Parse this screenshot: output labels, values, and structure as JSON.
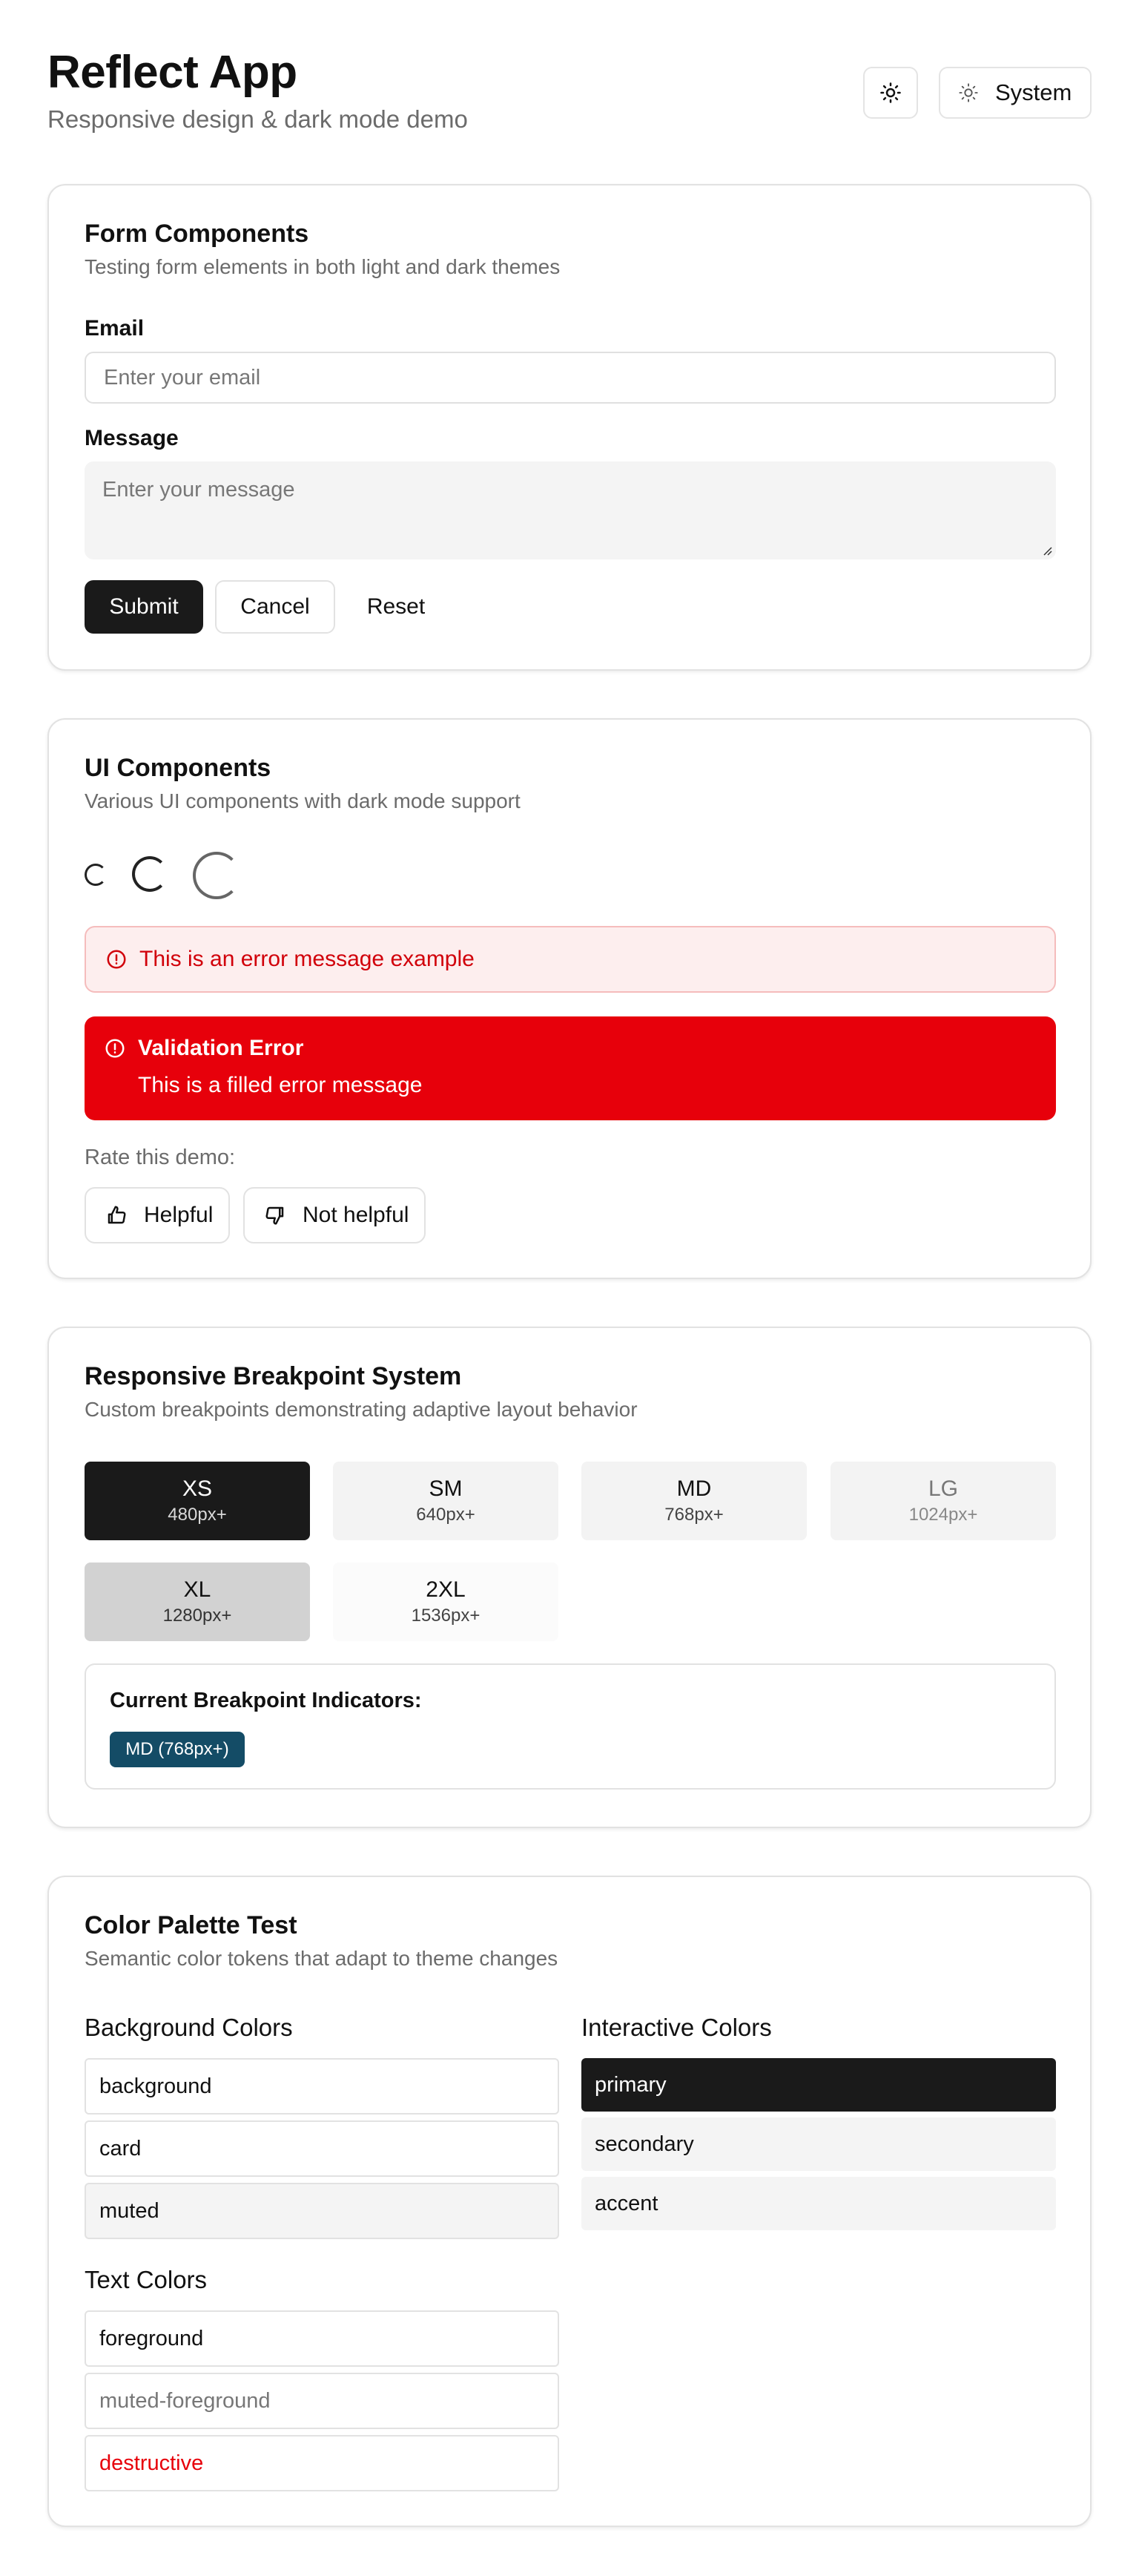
{
  "header": {
    "title": "Reflect App",
    "subtitle": "Responsive design & dark mode demo",
    "theme_toggle_icon": "sun-icon",
    "theme_select_label": "System"
  },
  "form_card": {
    "title": "Form Components",
    "description": "Testing form elements in both light and dark themes",
    "email_label": "Email",
    "email_value": "",
    "email_placeholder": "Enter your email",
    "message_label": "Message",
    "message_value": "",
    "message_placeholder": "Enter your message",
    "submit_label": "Submit",
    "cancel_label": "Cancel",
    "reset_label": "Reset"
  },
  "ui_card": {
    "title": "UI Components",
    "description": "Various UI components with dark mode support",
    "error_outline_text": "This is an error message example",
    "error_filled_title": "Validation Error",
    "error_filled_text": "This is a filled error message",
    "rate_prompt": "Rate this demo:",
    "helpful_label": "Helpful",
    "not_helpful_label": "Not helpful"
  },
  "breakpoint_card": {
    "title": "Responsive Breakpoint System",
    "description": "Custom breakpoints demonstrating adaptive layout behavior",
    "breakpoints": [
      {
        "name": "XS",
        "size": "480px+"
      },
      {
        "name": "SM",
        "size": "640px+"
      },
      {
        "name": "MD",
        "size": "768px+"
      },
      {
        "name": "LG",
        "size": "1024px+"
      },
      {
        "name": "XL",
        "size": "1280px+"
      },
      {
        "name": "2XL",
        "size": "1536px+"
      }
    ],
    "indicator_title": "Current Breakpoint Indicators:",
    "indicator_badge": "MD (768px+)"
  },
  "color_card": {
    "title": "Color Palette Test",
    "description": "Semantic color tokens that adapt to theme changes",
    "background_heading": "Background Colors",
    "background_colors": [
      "background",
      "card",
      "muted"
    ],
    "text_heading": "Text Colors",
    "text_colors": [
      "foreground",
      "muted-foreground",
      "destructive"
    ],
    "interactive_heading": "Interactive Colors",
    "interactive_colors": [
      "primary",
      "secondary",
      "accent"
    ]
  },
  "colors": {
    "primary": "#1a1a1a",
    "destructive": "#e7000b",
    "badge": "#144c66",
    "muted": "#f4f4f4"
  }
}
